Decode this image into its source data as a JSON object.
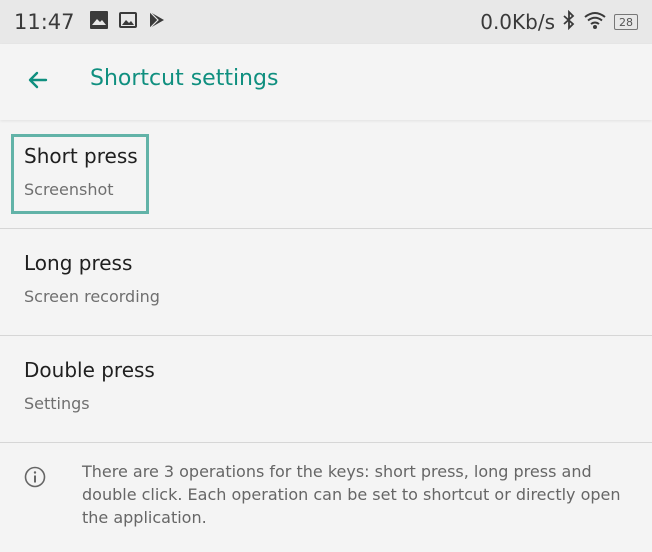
{
  "status_bar": {
    "time": "11:47",
    "speed": "0.0Kb/s",
    "battery": "28",
    "left_icons": [
      "photo-icon",
      "gallery-icon",
      "play-store-icon"
    ],
    "right_icons": [
      "bluetooth-icon",
      "wifi-icon",
      "battery-icon"
    ]
  },
  "app_bar": {
    "title": "Shortcut settings"
  },
  "items": [
    {
      "title": "Short press",
      "subtitle": "Screenshot"
    },
    {
      "title": "Long press",
      "subtitle": "Screen recording"
    },
    {
      "title": "Double press",
      "subtitle": "Settings"
    }
  ],
  "info": {
    "text": "There are 3 operations for the keys: short press, long press and double click. Each operation can be set to shortcut or directly open the application."
  },
  "colors": {
    "accent": "#0f8f7f",
    "highlight": "#62b3a8",
    "background": "#f4f4f4"
  }
}
